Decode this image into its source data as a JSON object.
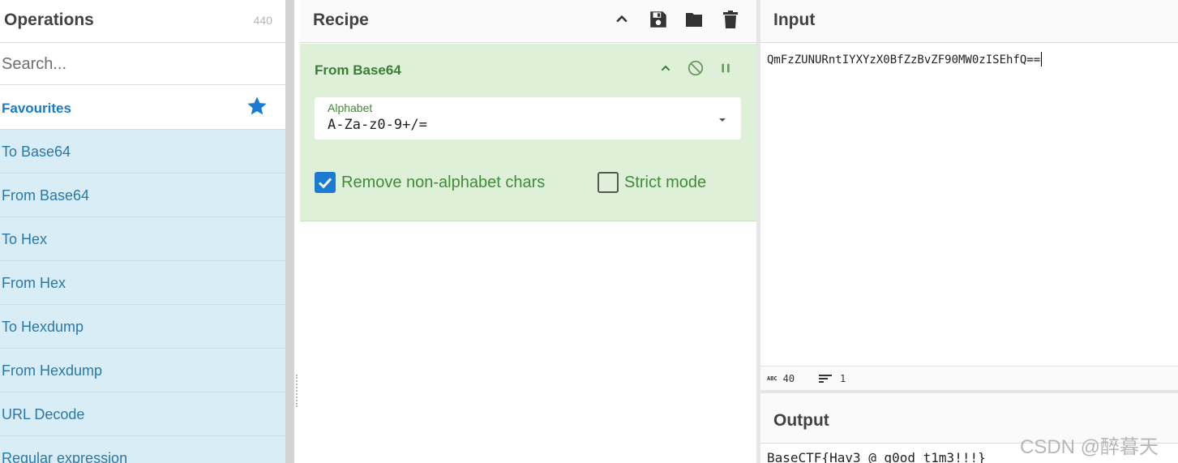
{
  "operations": {
    "title": "Operations",
    "count": "440",
    "search_placeholder": "Search...",
    "favourites_label": "Favourites",
    "items": [
      {
        "label": "To Base64"
      },
      {
        "label": "From Base64"
      },
      {
        "label": "To Hex"
      },
      {
        "label": "From Hex"
      },
      {
        "label": "To Hexdump"
      },
      {
        "label": "From Hexdump"
      },
      {
        "label": "URL Decode"
      },
      {
        "label": "Regular expression"
      }
    ]
  },
  "recipe": {
    "title": "Recipe",
    "operation": {
      "name": "From Base64",
      "alphabet_label": "Alphabet",
      "alphabet_value": "A-Za-z0-9+/=",
      "remove_non_alphabet_label": "Remove non-alphabet chars",
      "remove_non_alphabet_checked": true,
      "strict_mode_label": "Strict mode",
      "strict_mode_checked": false
    }
  },
  "input": {
    "title": "Input",
    "value": "QmFzZUNURntIYXYzX0BfZzBvZF90MW0zISEhfQ==",
    "stats": {
      "chars_label": "ABC",
      "chars": "40",
      "lines": "1"
    }
  },
  "output": {
    "title": "Output",
    "value": "BaseCTF{Hav3 @ g0od t1m3!!!}"
  },
  "watermark": "CSDN @醉暮天",
  "colors": {
    "accent_blue": "#1b7bd2",
    "op_list_bg": "#d9edf7",
    "recipe_card_bg": "#dff0d8",
    "recipe_green": "#3f8b3a"
  }
}
